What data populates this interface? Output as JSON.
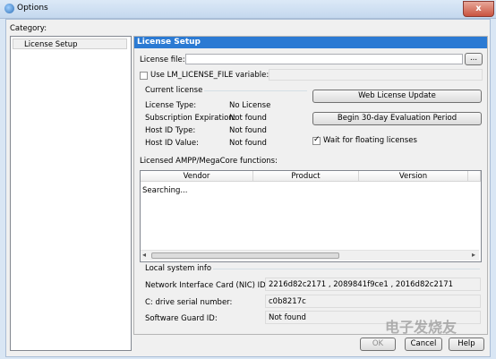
{
  "window": {
    "title": "Options",
    "close_glyph": "x"
  },
  "category": {
    "label": "Category:",
    "items": [
      "License Setup"
    ]
  },
  "panel": {
    "header": "License Setup",
    "license_file_label": "License file:",
    "license_file_value": "",
    "browse_label": "...",
    "use_env_label": "Use LM_LICENSE_FILE variable:",
    "use_env_checked": false,
    "current_license": {
      "title": "Current license",
      "rows": [
        {
          "label": "License Type:",
          "value": "No License"
        },
        {
          "label": "Subscription Expiration:",
          "value": "Not found"
        },
        {
          "label": "Host ID Type:",
          "value": "Not found"
        },
        {
          "label": "Host ID Value:",
          "value": "Not found"
        }
      ]
    },
    "web_update_button": "Web License Update",
    "eval_button": "Begin 30-day Evaluation Period",
    "wait_floating_label": "Wait for floating licenses",
    "wait_floating_checked": true,
    "functions_label": "Licensed AMPP/MegaCore functions:",
    "columns": [
      "Vendor",
      "Product",
      "Version"
    ],
    "status_text": "Searching...",
    "local_info": {
      "title": "Local system info",
      "rows": [
        {
          "label": "Network Interface Card (NIC) ID:",
          "value": "2216d82c2171 , 2089841f9ce1 , 2016d82c2171"
        },
        {
          "label": "C: drive serial number:",
          "value": "c0b8217c"
        },
        {
          "label": "Software Guard ID:",
          "value": "Not found"
        }
      ]
    }
  },
  "buttons": {
    "ok": "OK",
    "cancel": "Cancel",
    "help": "Help"
  },
  "watermark_text": "电子发烧友"
}
